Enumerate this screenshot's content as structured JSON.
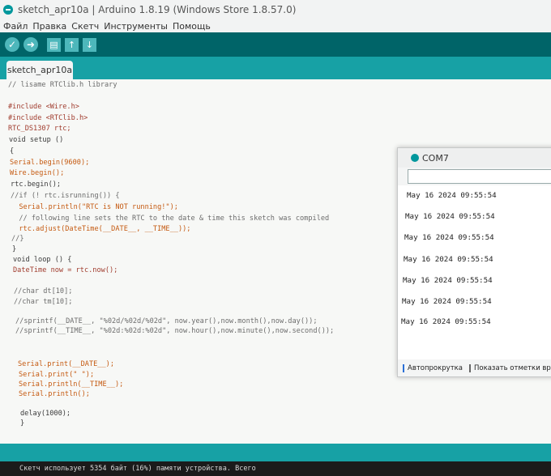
{
  "window": {
    "title": "sketch_apr10a | Arduino 1.8.19 (Windows Store 1.8.57.0)"
  },
  "menu": [
    "Файл",
    "Правка",
    "Скетч",
    "Инструменты",
    "Помощь"
  ],
  "toolbar": {
    "verify": "✓",
    "upload": "➜",
    "new": "▤",
    "open": "↑",
    "save": "↓"
  },
  "tab": {
    "label": "sketch_apr10a"
  },
  "code": [
    "// lisame RTClib.h library",
    "",
    "#include <Wire.h>",
    "#include <RTClib.h>",
    "RTC_DS1307 rtc;",
    "void setup ()",
    "{",
    "Serial.begin(9600);",
    "Wire.begin();",
    "rtc.begin();",
    "//if (! rtc.isrunning()) {",
    "  Serial.println(\"RTC is NOT running!\");",
    "  // following line sets the RTC to the date & time this sketch was compiled",
    "  rtc.adjust(DateTime(__DATE__, __TIME__));",
    "//}",
    "}",
    "void loop () {",
    "DateTime now = rtc.now();",
    "",
    "//char dt[10];",
    "//char tm[10];",
    "",
    "//sprintf(__DATE__, \"%02d/%02d/%02d\", now.year(),now.month(),now.day());",
    "//sprintf(__TIME__, \"%02d:%02d:%02d\", now.hour(),now.minute(),now.second());",
    "",
    "",
    "Serial.print(__DATE__);",
    "Serial.print(\" \");",
    "Serial.println(__TIME__);",
    "Serial.println();",
    "",
    "delay(1000);",
    "}"
  ],
  "serial": {
    "title": "COM7",
    "input_value": "",
    "lines": [
      "May 16 2024 09:55:54",
      "May 16 2024 09:55:54",
      "May 16 2024 09:55:54",
      "May 16 2024 09:55:54",
      "May 16 2024 09:55:54",
      "May 16 2024 09:55:54",
      "May 16 2024 09:55:54"
    ],
    "autoscroll_label": "Автопрокрутка",
    "timestamp_label": "Показать отметки времени"
  },
  "console": {
    "text": "Скетч использует 5354 байт (16%) памяти устройства. Всего"
  },
  "colors": {
    "toolbar": "#006468",
    "tabstrip": "#17a1a5",
    "button": "#4db7bb"
  }
}
